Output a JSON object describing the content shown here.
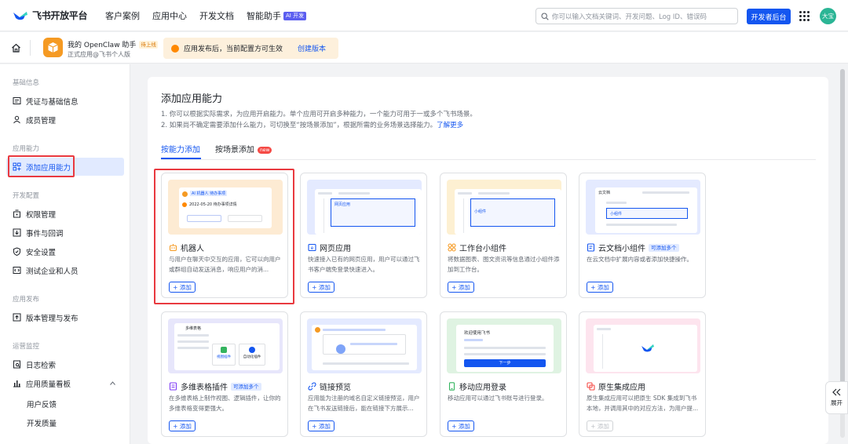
{
  "topnav": {
    "logo_text": "飞书开放平台",
    "links": [
      "客户案例",
      "应用中心",
      "开发文档",
      "智能助手"
    ],
    "ai_badge": "AI 开发",
    "search_placeholder": "你可以输入文档关键词、开发问题、Log ID、错误码",
    "dev_console": "开发者后台",
    "avatar_text": "大宝"
  },
  "subbar": {
    "app_name": "我的 OpenClaw 助手",
    "status_tag": "待上线",
    "app_type": "正式应用@飞书个人版",
    "notice_text": "应用发布后，当前配置方可生效",
    "notice_link": "创建版本"
  },
  "sidebar": {
    "groups": [
      "基础信息",
      "应用能力",
      "开发配置",
      "应用发布",
      "运营监控"
    ],
    "items": {
      "credentials": "凭证与基础信息",
      "members": "成员管理",
      "add_capability": "添加应用能力",
      "permissions": "权限管理",
      "events": "事件与回调",
      "security": "安全设置",
      "test_org": "测试企业和人员",
      "versions": "版本管理与发布",
      "logs": "日志检索",
      "quality": "应用质量看板",
      "feedback": "用户反馈",
      "dev_quality": "开发质量"
    }
  },
  "main": {
    "title": "添加应用能力",
    "desc1": "1. 你可以根据实际需求，为应用开启能力。单个应用可开启多种能力，一个能力可用于一或多个飞书场景。",
    "desc2": "2. 如果尚不确定需要添加什么能力，可切换至“按场景添加”，根据所需的业务场景选择能力。",
    "learn_more": "了解更多",
    "tabs": [
      "按能力添加",
      "按场景添加"
    ],
    "new_badge": "new",
    "multi_tag": "可添加多个",
    "add_label": "+ 添加",
    "cards": [
      {
        "title": "机器人",
        "desc": "与用户在聊天中交互的应用，它可以向用户或群组自动发送消息，响应用户的消...",
        "icon": "robot-icon",
        "thumb": "#fdebd3"
      },
      {
        "title": "网页应用",
        "desc": "快速接入已有的网页应用，用户可以通过飞书客户端免登录快速进入。",
        "icon": "web-icon",
        "thumb": "#e4eaff"
      },
      {
        "title": "工作台小组件",
        "desc": "将数据图表、图文资讯等信息通过小组件添加到工作台。",
        "icon": "widget-icon",
        "thumb": "#fdf0d2"
      },
      {
        "title": "云文档小组件",
        "desc": "在云文档中扩展内容或者添加快捷操作。",
        "icon": "doc-icon",
        "thumb": "#e4eaff"
      },
      {
        "title": "多维表格插件",
        "desc": "在多维表格上制作视图、逻辑插件，让你的多维表格变得更强大。",
        "icon": "bitable-icon",
        "thumb": "#e7e6fb"
      },
      {
        "title": "链接预览",
        "desc": "应用能为注册的域名自定义链接预览，用户在飞书发送链接后，能在链接下方展示...",
        "icon": "link-icon",
        "thumb": "#e4eaff"
      },
      {
        "title": "移动应用登录",
        "desc": "移动应用可以通过飞书账号进行登录。",
        "icon": "mobile-icon",
        "thumb": "#dff3e2"
      },
      {
        "title": "原生集成应用",
        "desc": "原生集成应用可以把原生 SDK 集成到飞书本地，并调用其中的对应方法，为用户提...",
        "icon": "native-icon",
        "thumb": "#fde4ee"
      }
    ],
    "thumb_texts": {
      "bot_tag": "AI 机器人  待办事项",
      "bot_item": "2022-05-20 待办事项详情",
      "web_tag": "网页应用",
      "widget_tag": "小组件",
      "doc_head": "云文档",
      "doc_tag": "小组件",
      "bitable_head": "多维表格",
      "bitable_btn1": "视图插件",
      "bitable_btn2": "自动化插件",
      "mobile_title": "欢迎使用飞书",
      "mobile_btn": "下一步"
    }
  },
  "expand_label": "展开"
}
